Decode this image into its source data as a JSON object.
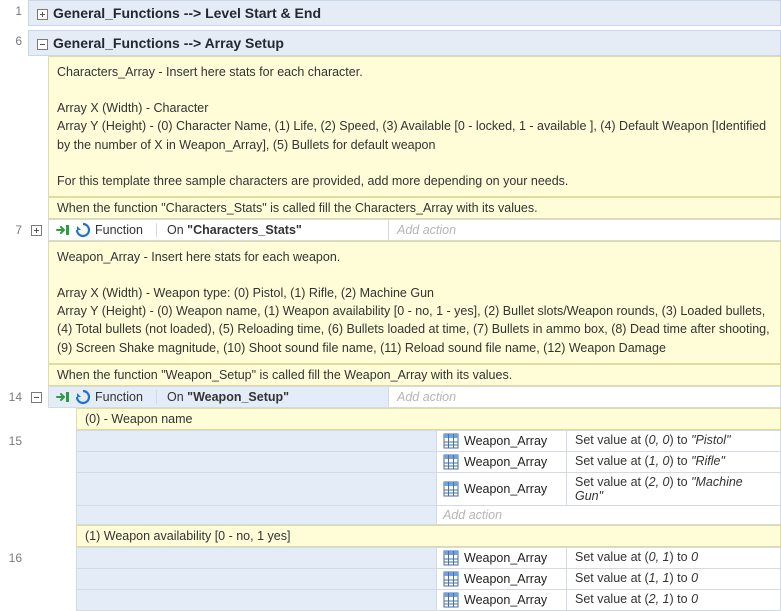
{
  "groups": {
    "g1": {
      "line": "1",
      "title": "General_Functions --> Level Start & End"
    },
    "g2": {
      "line": "6",
      "title": "General_Functions --> Array Setup"
    }
  },
  "comments": {
    "chars_array": "Characters_Array - Insert here stats for each character.\n\nArray X (Width) - Character\nArray Y (Height) - (0) Character Name, (1) Life, (2) Speed, (3) Available [0 - locked, 1 - available ], (4) Default Weapon [Identified by the number of X in Weapon_Array], (5) Bullets for default weapon\n\nFor this template three sample characters are provided, add more depending on your needs.",
    "chars_when": "When the function \"Characters_Stats\" is called fill the Characters_Array with its values.",
    "weapon_array": "Weapon_Array - Insert here stats for each weapon.\n\nArray X (Width) - Weapon type: (0) Pistol, (1) Rifle, (2) Machine Gun\nArray Y (Height) - (0) Weapon name, (1) Weapon availability [0 - no, 1 - yes], (2) Bullet slots/Weapon rounds, (3) Loaded bullets, (4) Total bullets (not loaded), (5) Reloading time, (6) Bullets loaded at time, (7) Bullets in ammo box, (8) Dead time after shooting, (9) Screen Shake magnitude, (10) Shoot sound file name, (11) Reload sound file name, (12) Weapon Damage",
    "weapon_when": "When the function \"Weapon_Setup\" is called fill the Weapon_Array with its values.",
    "sub0": "(0) - Weapon name",
    "sub1": "(1) Weapon availability [0 - no, 1 yes]"
  },
  "events": {
    "e7": {
      "line": "7",
      "obj": "Function",
      "on_prefix": "On ",
      "on_name": "\"Characters_Stats\"",
      "add_action": "Add action"
    },
    "e14": {
      "line": "14",
      "obj": "Function",
      "on_prefix": "On ",
      "on_name": "\"Weapon_Setup\"",
      "add_action": "Add action"
    }
  },
  "lines": {
    "l15": "15",
    "l16": "16"
  },
  "array_obj": "Weapon_Array",
  "actions_name": [
    {
      "pre": "Set value at (",
      "coord": "0, 0",
      "mid": ") to ",
      "val": "\"Pistol\""
    },
    {
      "pre": "Set value at (",
      "coord": "1, 0",
      "mid": ") to ",
      "val": "\"Rifle\""
    },
    {
      "pre": "Set value at (",
      "coord": "2, 0",
      "mid": ") to ",
      "val": "\"Machine Gun\""
    }
  ],
  "actions_avail": [
    {
      "pre": "Set value at (",
      "coord": "0, 1",
      "mid": ") to ",
      "val": "0"
    },
    {
      "pre": "Set value at (",
      "coord": "1, 1",
      "mid": ") to ",
      "val": "0"
    },
    {
      "pre": "Set value at (",
      "coord": "2, 1",
      "mid": ") to ",
      "val": "0"
    }
  ],
  "add_action": "Add action"
}
